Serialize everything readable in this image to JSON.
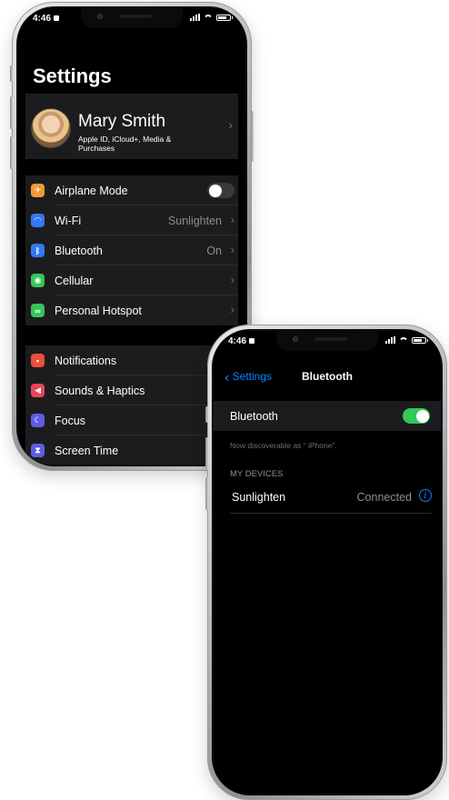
{
  "phone1": {
    "status": {
      "time": "4:46"
    },
    "title": "Settings",
    "profile": {
      "name": "Mary Smith",
      "subtitle": "Apple ID, iCloud+, Media & Purchases"
    },
    "group1": [
      {
        "label": "Airplane Mode",
        "icon": "airplane-icon",
        "color": "#f09a37",
        "toggle": false
      },
      {
        "label": "Wi-Fi",
        "icon": "wifi-icon",
        "color": "#3478f6",
        "value": "Sunlighten"
      },
      {
        "label": "Bluetooth",
        "icon": "bluetooth-icon",
        "color": "#3478f6",
        "value": "On"
      },
      {
        "label": "Cellular",
        "icon": "cellular-icon",
        "color": "#34c759"
      },
      {
        "label": "Personal Hotspot",
        "icon": "hotspot-icon",
        "color": "#34c759"
      }
    ],
    "group2": [
      {
        "label": "Notifications",
        "icon": "notifications-icon",
        "color": "#eb4e3d"
      },
      {
        "label": "Sounds & Haptics",
        "icon": "sounds-icon",
        "color": "#eb445a"
      },
      {
        "label": "Focus",
        "icon": "focus-icon",
        "color": "#5e5ce6"
      },
      {
        "label": "Screen Time",
        "icon": "screen-time-icon",
        "color": "#5e5ce6"
      }
    ]
  },
  "phone2": {
    "status": {
      "time": "4:46"
    },
    "nav": {
      "back": "Settings",
      "title": "Bluetooth"
    },
    "bluetooth_row": {
      "label": "Bluetooth",
      "toggle": true
    },
    "discoverable": "Now discoverable as “ iPhone”.",
    "section_header": "MY DEVICES",
    "device": {
      "name": "Sunlighten",
      "status": "Connected"
    }
  }
}
